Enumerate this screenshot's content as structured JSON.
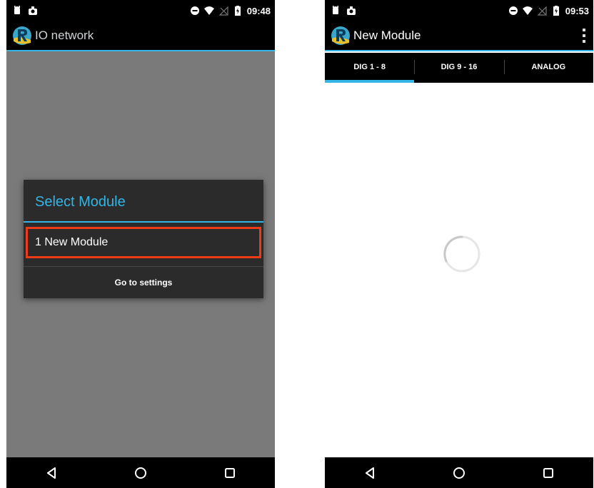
{
  "phone_left": {
    "status_time": "09:48",
    "app_title": "IO network",
    "dialog": {
      "title": "Select Module",
      "item": "1 New Module",
      "button": "Go to settings"
    }
  },
  "phone_right": {
    "status_time": "09:53",
    "app_title": "New Module",
    "tabs": [
      {
        "label": "DIG 1 - 8",
        "active": true
      },
      {
        "label": "DIG 9 - 16",
        "active": false
      },
      {
        "label": "ANALOG",
        "active": false
      }
    ]
  },
  "colors": {
    "accent": "#33b5e5",
    "highlight_border": "#ec3b16",
    "dim_background": "#7a7a7a",
    "dialog_bg": "#2b2b2b"
  },
  "icons": {
    "status_left": [
      "android-icon",
      "notification-icon"
    ],
    "status_right": [
      "minus-circle-icon",
      "wifi-icon",
      "signal-icon",
      "battery-icon"
    ],
    "nav": [
      "back-icon",
      "home-icon",
      "recents-icon"
    ],
    "app_logo": "r-logo-icon"
  }
}
